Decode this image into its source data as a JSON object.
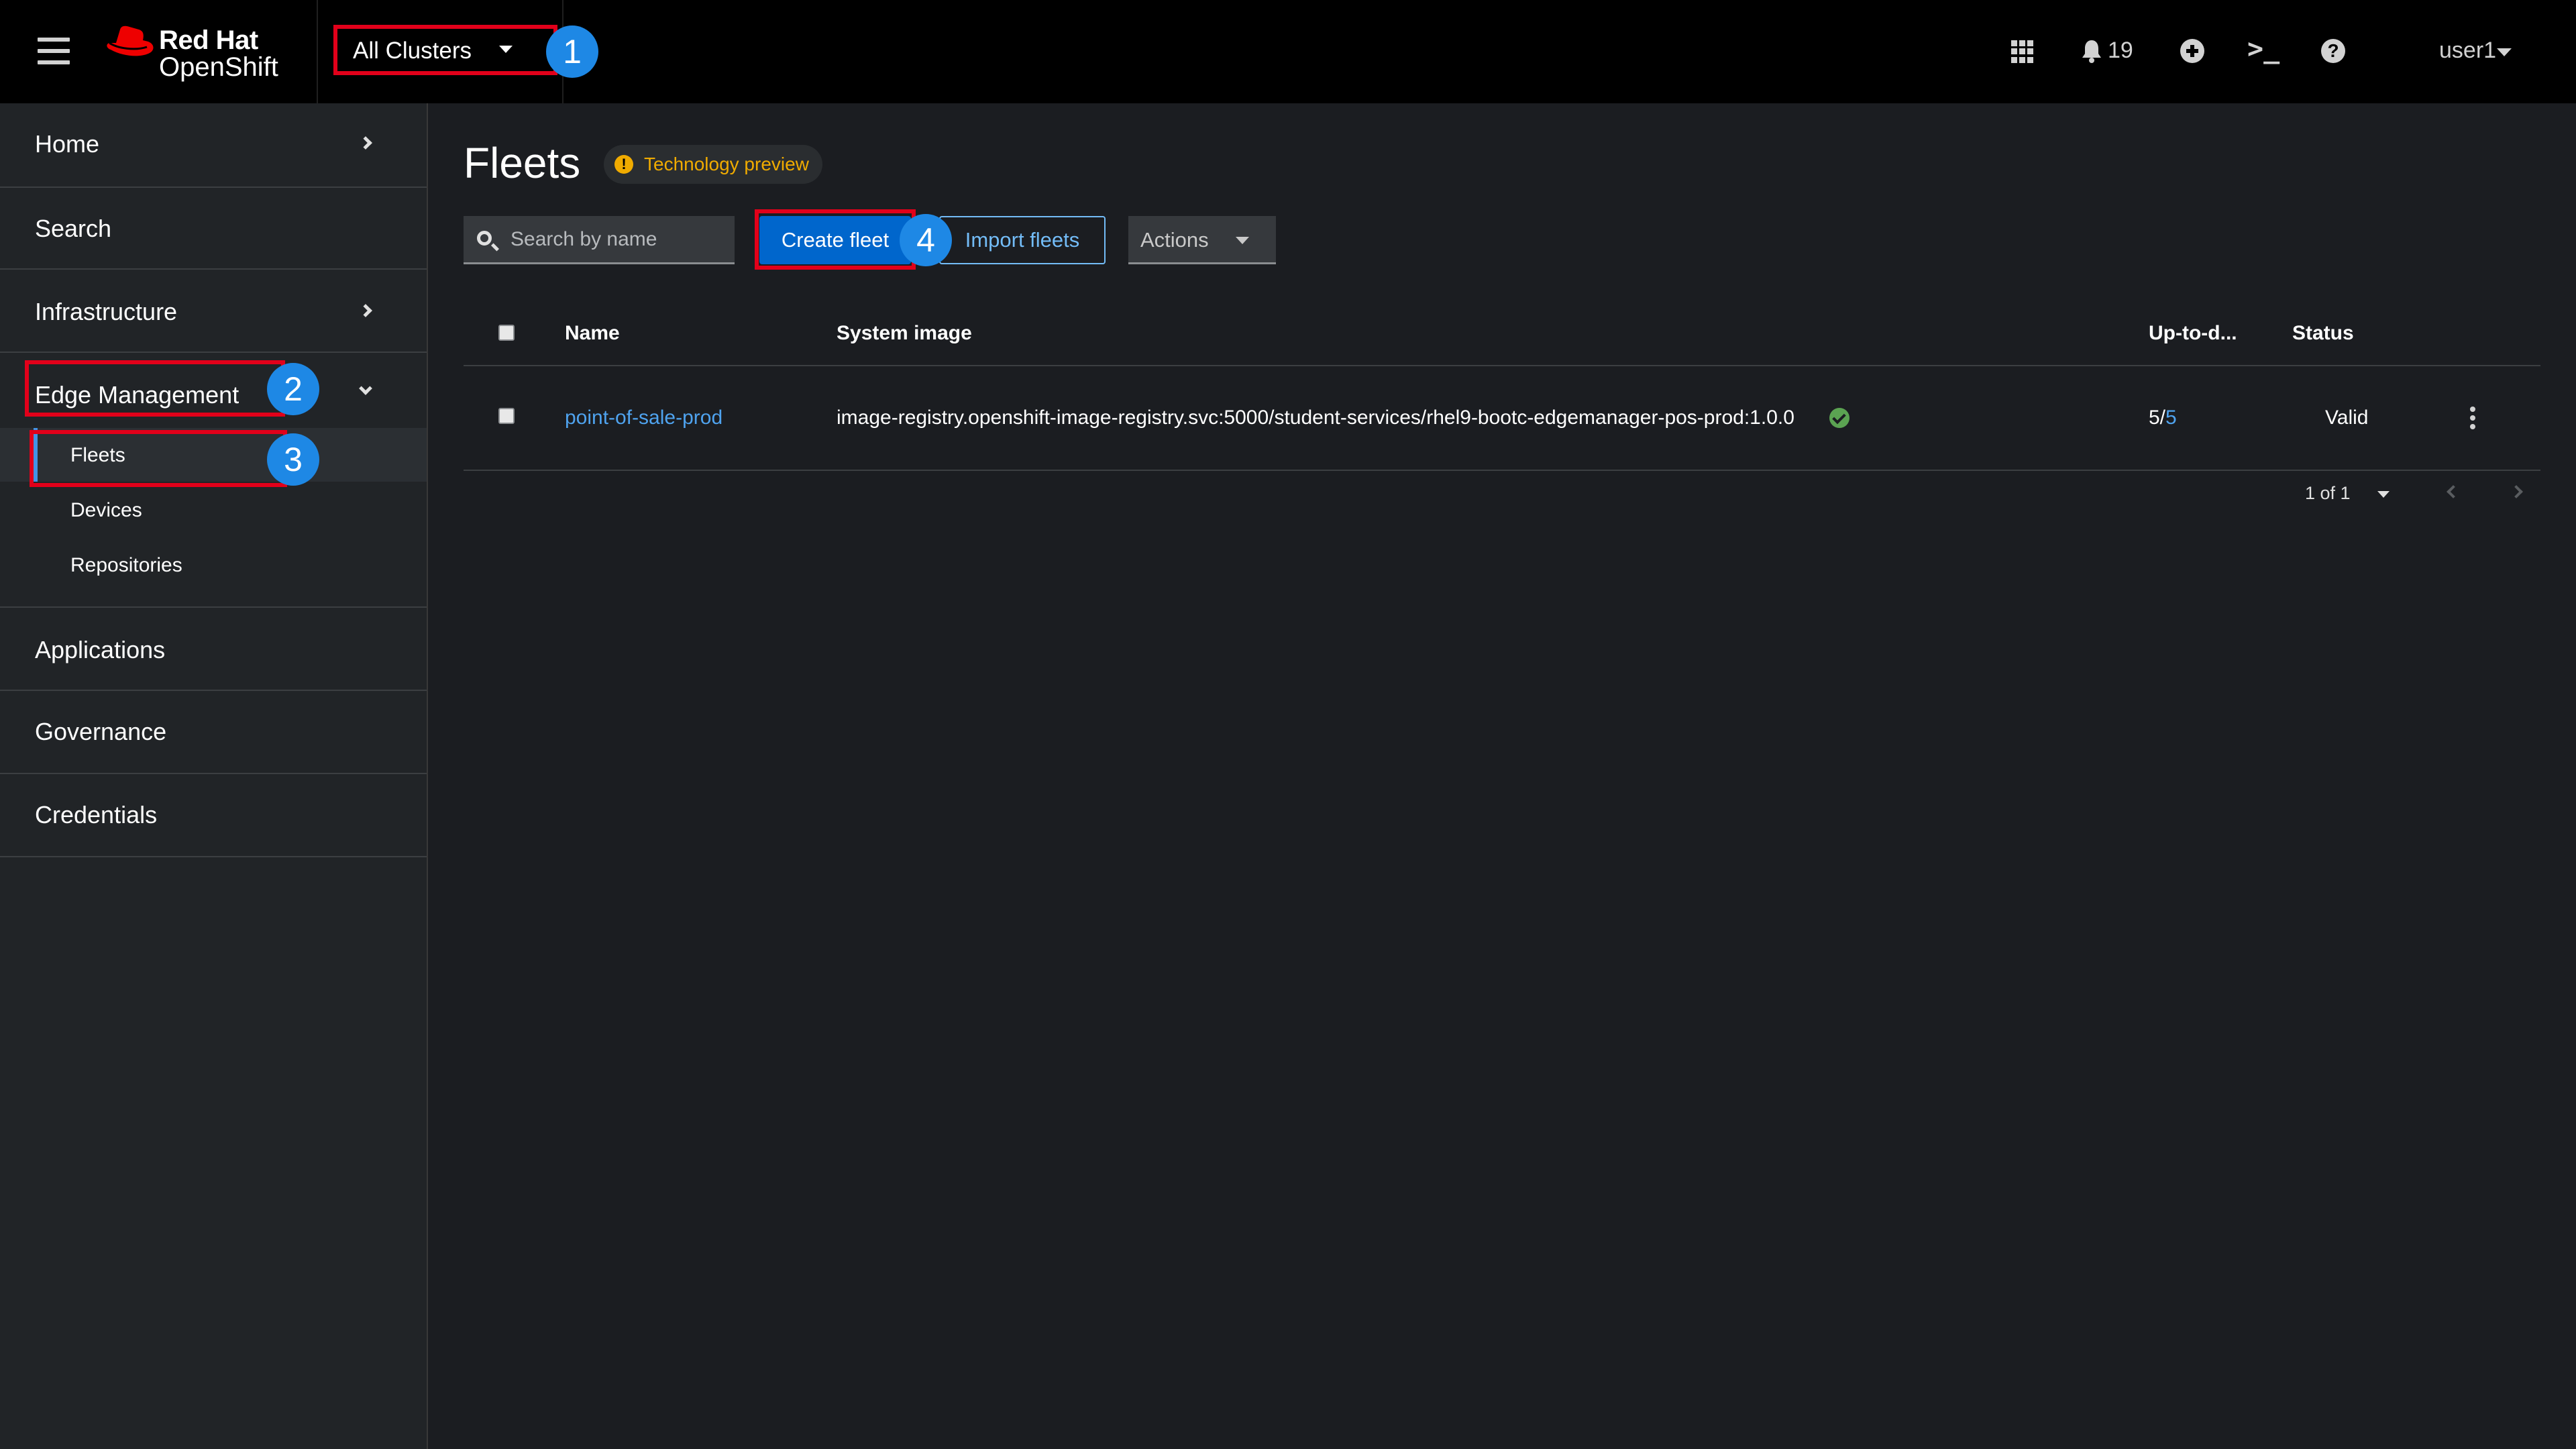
{
  "masthead": {
    "brand_line1": "Red Hat",
    "brand_line2": "OpenShift",
    "cluster_selector": "All Clusters",
    "notification_count": "19",
    "user": "user1",
    "terminal_glyph": ">_",
    "help_glyph": "?"
  },
  "sidebar": {
    "items": [
      {
        "label": "Home",
        "expandable": true
      },
      {
        "label": "Search",
        "expandable": false
      },
      {
        "label": "Infrastructure",
        "expandable": true
      },
      {
        "label": "Edge Management",
        "expanded": true
      },
      {
        "label": "Applications",
        "expandable": false
      },
      {
        "label": "Governance",
        "expandable": false
      },
      {
        "label": "Credentials",
        "expandable": false
      }
    ],
    "edge_subitems": [
      {
        "label": "Fleets",
        "active": true
      },
      {
        "label": "Devices",
        "active": false
      },
      {
        "label": "Repositories",
        "active": false
      }
    ]
  },
  "page": {
    "title": "Fleets",
    "badge": "Technology preview",
    "badge_glyph": "!"
  },
  "toolbar": {
    "search_placeholder": "Search by name",
    "create_label": "Create fleet",
    "import_label": "Import fleets",
    "actions_label": "Actions"
  },
  "table": {
    "columns": [
      "Name",
      "System image",
      "Up-to-d...",
      "Status"
    ],
    "rows": [
      {
        "name": "point-of-sale-prod",
        "system_image": "image-registry.openshift-image-registry.svc:5000/student-services/rhel9-bootc-edgemanager-pos-prod:1.0.0",
        "uptodate_prefix": "5/",
        "uptodate_total": "5",
        "status": "Valid"
      }
    ]
  },
  "pagination": {
    "label": "1 of 1"
  },
  "callouts": [
    "1",
    "2",
    "3",
    "4"
  ],
  "colors": {
    "highlight": "#e2001a",
    "callout": "#1e88e5",
    "primary": "#0066cc",
    "link": "#4fa3ef",
    "valid": "#5ba352",
    "warning": "#f0ab00"
  }
}
